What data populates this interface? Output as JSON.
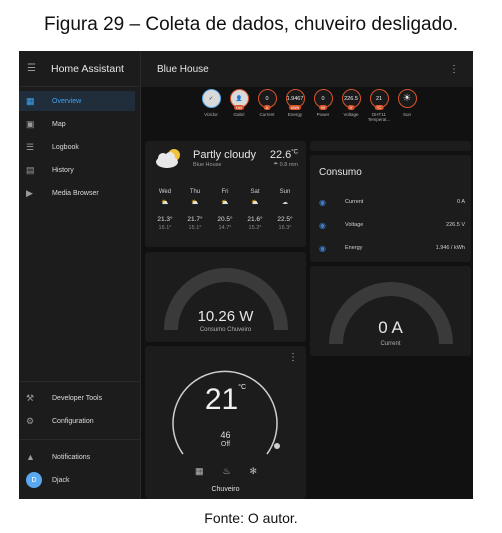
{
  "caption": "Figura 29 – Coleta de dados, chuveiro desligado.",
  "footer": "Fonte: O autor.",
  "sidebar": {
    "title": "Home Assistant",
    "items": [
      {
        "label": "Overview",
        "icon": "dashboard-icon"
      },
      {
        "label": "Map",
        "icon": "map-icon"
      },
      {
        "label": "Logbook",
        "icon": "list-icon"
      },
      {
        "label": "History",
        "icon": "chart-icon"
      },
      {
        "label": "Media Browser",
        "icon": "play-icon"
      }
    ],
    "developer_tools": "Developer Tools",
    "configuration": "Configuration",
    "notifications": "Notifications",
    "user": "Djack",
    "user_initial": "D"
  },
  "topbar": {
    "title": "Blue House"
  },
  "badges": [
    {
      "value": "✓",
      "label": "Vizidor",
      "tag": ""
    },
    {
      "value": "👤",
      "label": "Gabri",
      "tag": "Hei"
    },
    {
      "value": "0",
      "label": "Current",
      "tag": "A"
    },
    {
      "value": "1.9467",
      "label": "Energy",
      "tag": "kWh"
    },
    {
      "value": "0",
      "label": "Power",
      "tag": "W"
    },
    {
      "value": "226.5",
      "label": "Voltage",
      "tag": "V"
    },
    {
      "value": "21",
      "label": "DHT11 Temperat...",
      "tag": "°C"
    },
    {
      "value": "☀",
      "label": "Sun",
      "tag": ""
    }
  ],
  "weather": {
    "condition": "Partly cloudy",
    "location": "Blue House",
    "temperature": "22.6",
    "temp_unit": "°C",
    "precip": "0.8 mm",
    "forecast": [
      {
        "day": "Wed",
        "hi": "21.3°",
        "lo": "16.1°"
      },
      {
        "day": "Thu",
        "hi": "21.7°",
        "lo": "15.1°"
      },
      {
        "day": "Fri",
        "hi": "20.5°",
        "lo": "14.7°"
      },
      {
        "day": "Sat",
        "hi": "21.6°",
        "lo": "15.2°"
      },
      {
        "day": "Sun",
        "hi": "22.5°",
        "lo": "16.3°"
      }
    ]
  },
  "consumo": {
    "title": "Consumo",
    "rows": [
      {
        "name": "Current",
        "value": "0 A"
      },
      {
        "name": "Voltage",
        "value": "226.5 V"
      },
      {
        "name": "Energy",
        "value": "1.946 / kWh"
      }
    ]
  },
  "gauge_power": {
    "value": "10.26 W",
    "label": "Consumo Chuveiro"
  },
  "gauge_current": {
    "value": "0 A",
    "label": "Current"
  },
  "thermostat": {
    "temperature": "21",
    "unit": "°C",
    "target": "46",
    "mode": "Off",
    "name": "Chuveiro"
  },
  "colors": {
    "accent": "#40a4f0",
    "badge_border": "#d9542b",
    "gauge_track": "#3a3a3a"
  }
}
